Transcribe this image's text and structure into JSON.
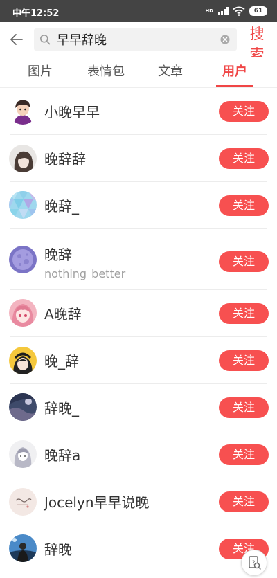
{
  "status_bar": {
    "time": "中午12:52",
    "network_label": "HD",
    "battery_level": "61"
  },
  "search": {
    "query": "早早辞晚",
    "submit_label": "搜索"
  },
  "tabs": [
    {
      "label": "图片",
      "active": false
    },
    {
      "label": "表情包",
      "active": false
    },
    {
      "label": "文章",
      "active": false
    },
    {
      "label": "用户",
      "active": true
    }
  ],
  "users": [
    {
      "name": "小晚早早",
      "bio": "",
      "follow_label": "关注"
    },
    {
      "name": "晚辞辞",
      "bio": "",
      "follow_label": "关注"
    },
    {
      "name": "晚辞_",
      "bio": "",
      "follow_label": "关注"
    },
    {
      "name": "晚辞",
      "bio": "nothing  better",
      "follow_label": "关注"
    },
    {
      "name": "A晚辞",
      "bio": "",
      "follow_label": "关注"
    },
    {
      "name": "晚_辞",
      "bio": "",
      "follow_label": "关注"
    },
    {
      "name": "辞晚_",
      "bio": "",
      "follow_label": "关注"
    },
    {
      "name": "晚辞a",
      "bio": "",
      "follow_label": "关注"
    },
    {
      "name": "Jocelyn早早说晚",
      "bio": "",
      "follow_label": "关注"
    },
    {
      "name": "辞晚",
      "bio": "",
      "follow_label": "关注"
    }
  ],
  "colors": {
    "accent": "#f04646",
    "follow_button": "#f75050",
    "status_bar": "#444444"
  },
  "icons": {
    "back": "arrow-left-icon",
    "search": "search-icon",
    "clear": "clear-icon",
    "floating": "image-search-icon"
  }
}
